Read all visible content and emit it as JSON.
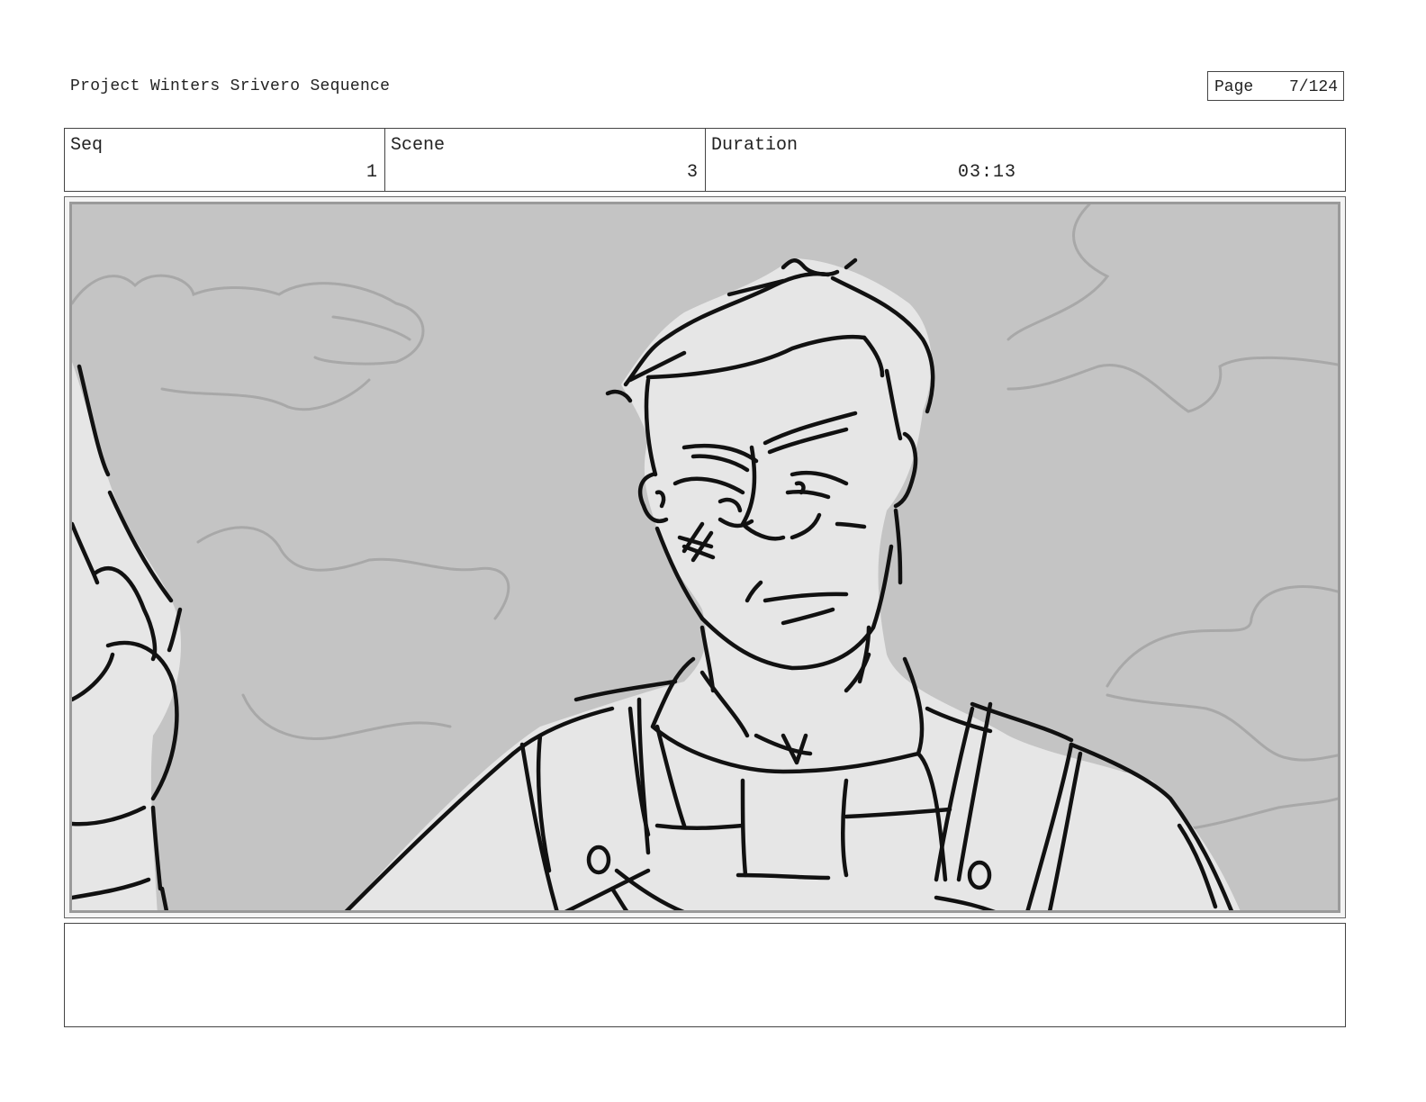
{
  "header": {
    "project_title": "Project Winters Srivero Sequence",
    "page_label": "Page",
    "page_value": "7/124"
  },
  "info": {
    "seq_label": "Seq",
    "seq_value": "1",
    "scene_label": "Scene",
    "scene_value": "3",
    "duration_label": "Duration",
    "duration_value": "03:13"
  },
  "panel": {
    "sky_color": "#c4c4c4",
    "skin_color": "#e6e6e6",
    "line_color": "#111111",
    "cloud_color": "#a8a8a8"
  },
  "notes": {
    "text": ""
  }
}
